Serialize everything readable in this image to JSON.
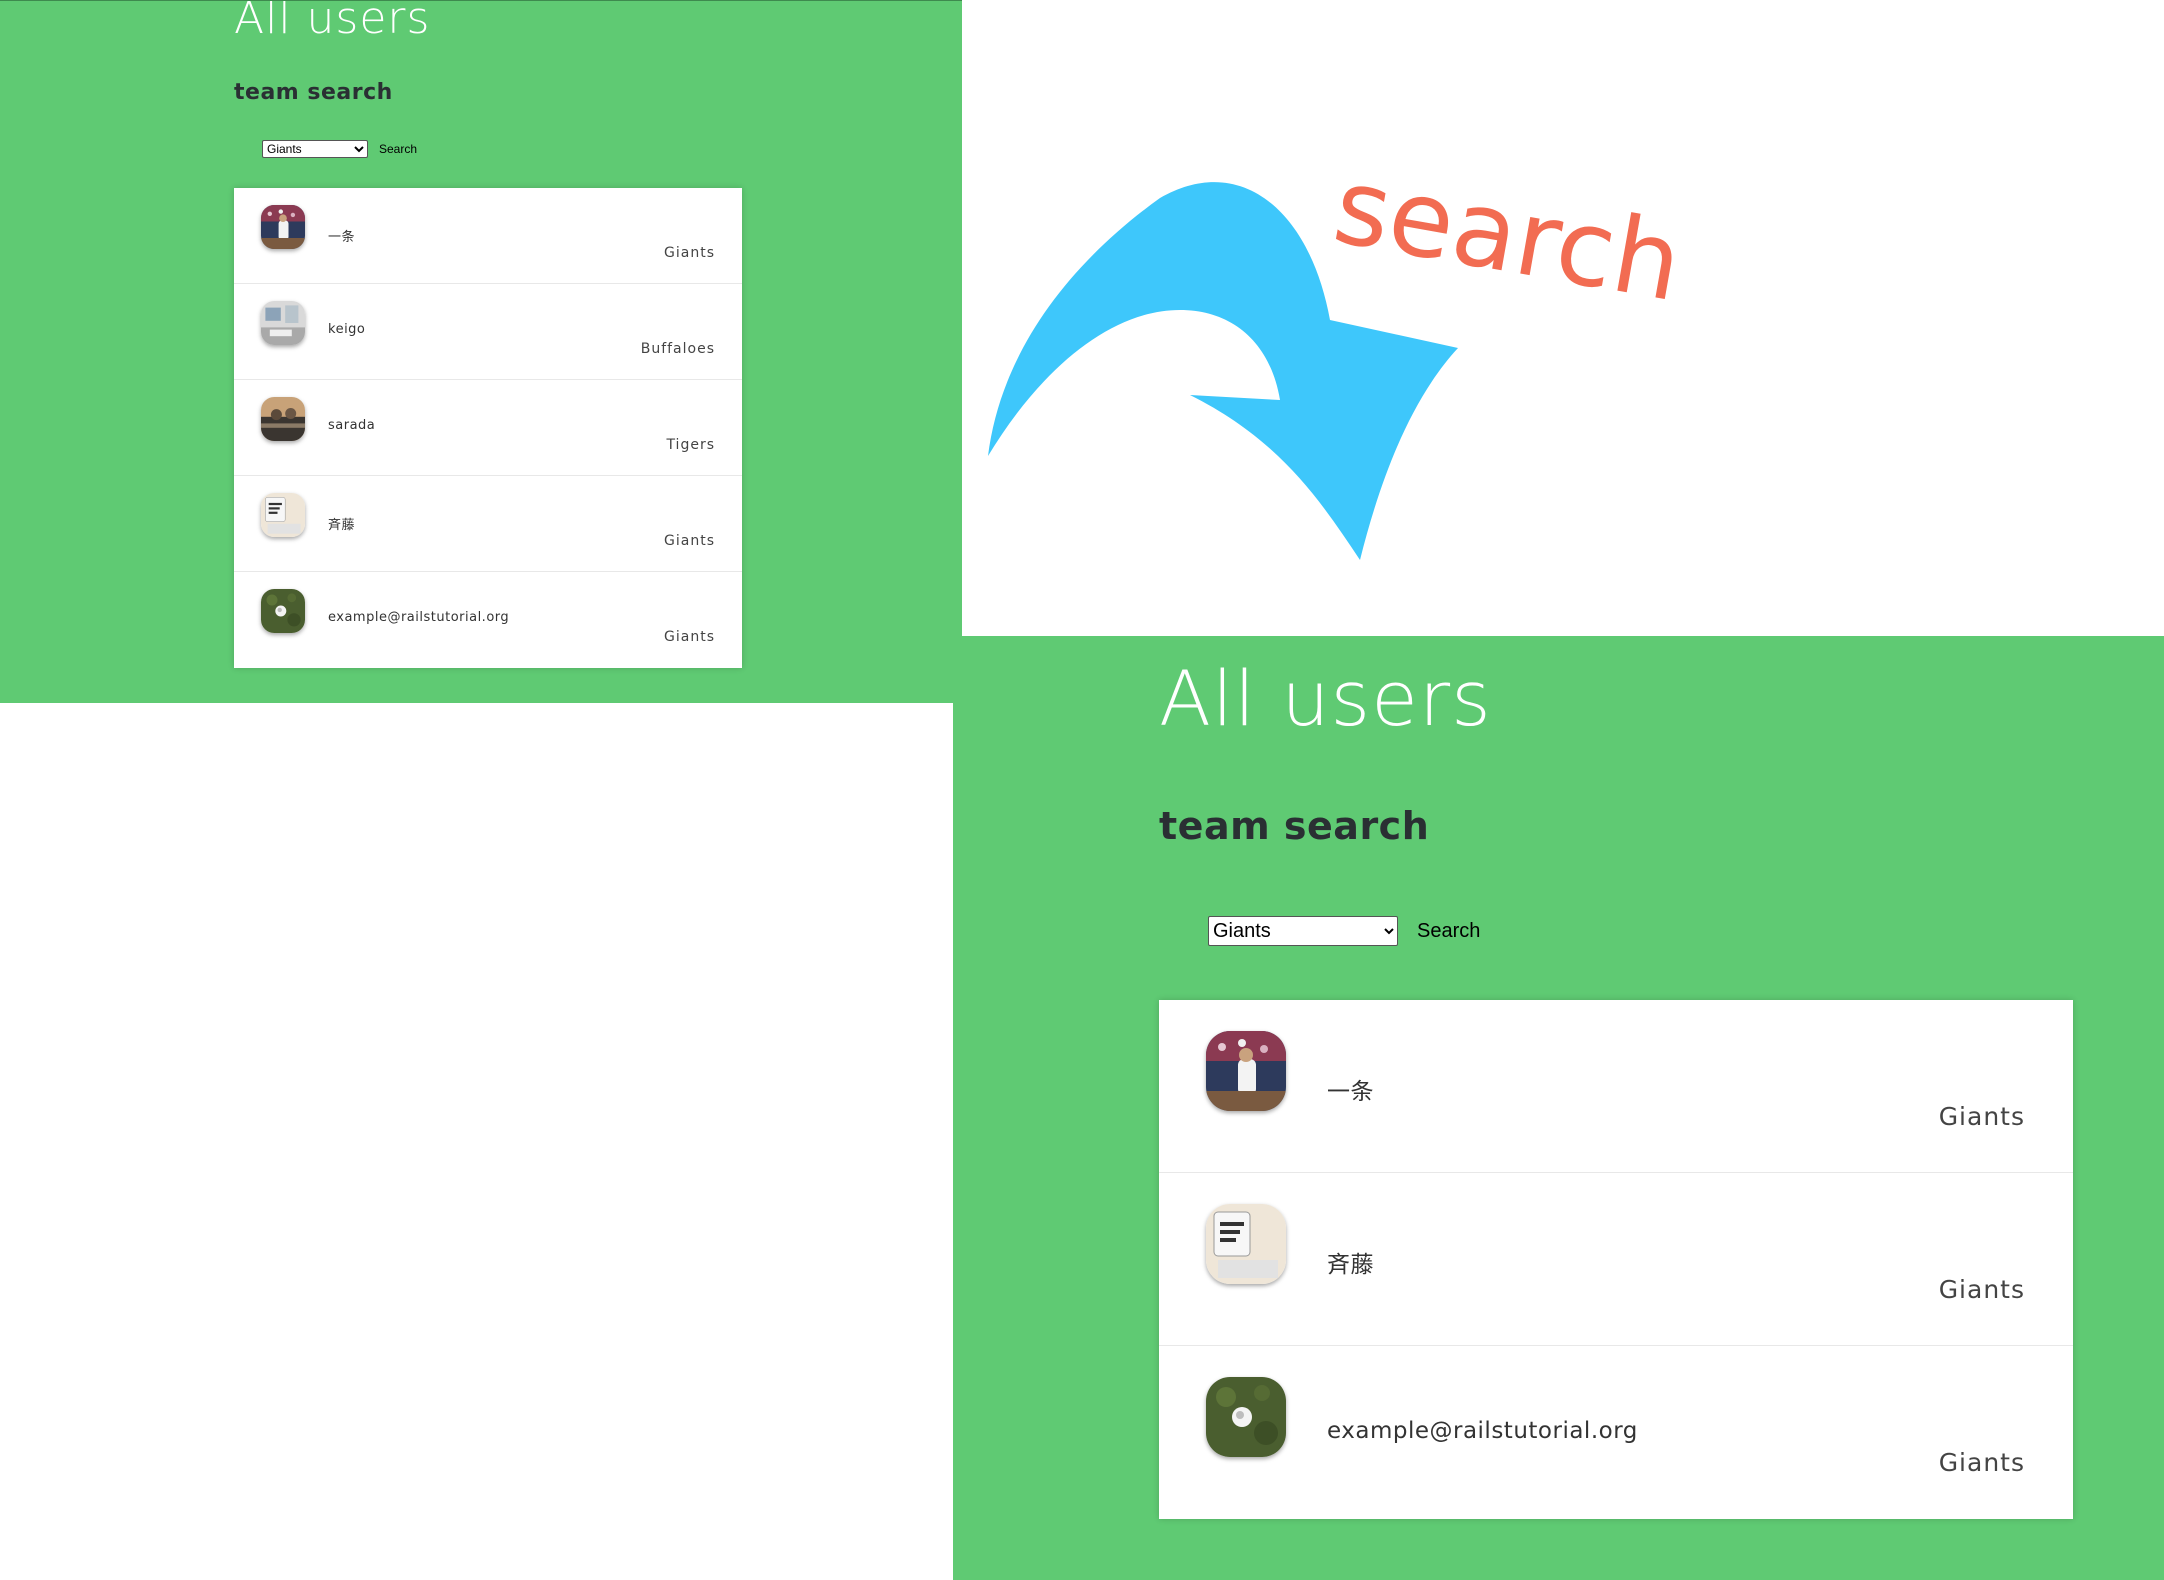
{
  "colors": {
    "panel_bg": "#5fca73",
    "arrow": "#3ec7fb",
    "search_word": "#f26c52"
  },
  "annotation": {
    "word": "search"
  },
  "before": {
    "title": "All users",
    "subtitle": "team search",
    "select_value": "Giants",
    "search_label": "Search",
    "users": [
      {
        "name": "一条",
        "team": "Giants",
        "avatar": "baseball-player-photo"
      },
      {
        "name": "keigo",
        "team": "Buffaloes",
        "avatar": "desk-photo"
      },
      {
        "name": "sarada",
        "team": "Tigers",
        "avatar": "statue-photo"
      },
      {
        "name": "斉藤",
        "team": "Giants",
        "avatar": "mug-photo"
      },
      {
        "name": "example@railstutorial.org",
        "team": "Giants",
        "avatar": "baseball-on-grass-photo"
      }
    ]
  },
  "after": {
    "title": "All users",
    "subtitle": "team search",
    "select_value": "Giants",
    "search_label": "Search",
    "users": [
      {
        "name": "一条",
        "team": "Giants",
        "avatar": "baseball-player-photo"
      },
      {
        "name": "斉藤",
        "team": "Giants",
        "avatar": "mug-photo"
      },
      {
        "name": "example@railstutorial.org",
        "team": "Giants",
        "avatar": "baseball-on-grass-photo"
      }
    ]
  }
}
